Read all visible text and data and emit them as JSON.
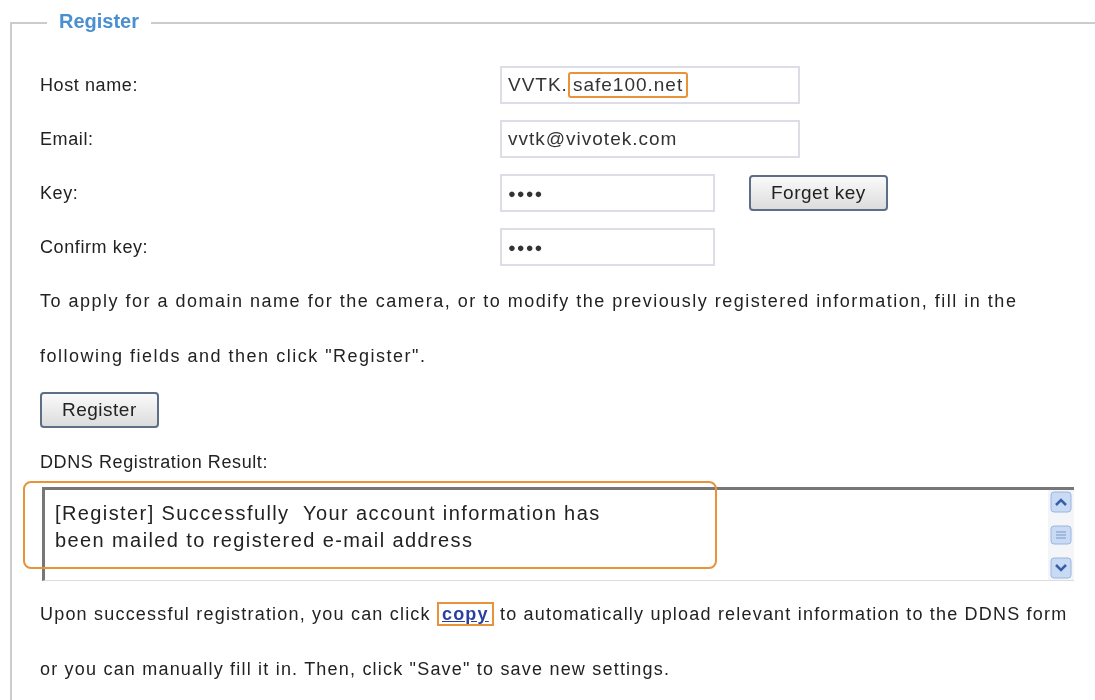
{
  "section": {
    "title": "Register"
  },
  "fields": [
    {
      "label": "Host name:",
      "kind": "text",
      "value_prefix": "VVTK.",
      "value_highlight": "safe100.net"
    },
    {
      "label": "Email:",
      "kind": "text",
      "value_prefix": "vvtk@vivotek.com"
    },
    {
      "label": "Key:",
      "kind": "password",
      "value_prefix": "●●●●",
      "button": "Forget key"
    },
    {
      "label": "Confirm key:",
      "kind": "password",
      "value_prefix": "●●●●"
    }
  ],
  "instructions": "To apply for a domain name for the camera, or to modify the previously registered information, fill in the following fields and then click \"Register\".",
  "register_button": "Register",
  "result": {
    "label": "DDNS Registration Result:",
    "text": "[Register] Successfully  Your account information has\nbeen mailed to registered e-mail address",
    "highlighted": true
  },
  "footer": {
    "before": "Upon successful registration, you can click",
    "link": "copy",
    "link_highlighted": true,
    "after": "to automatically upload relevant information to the DDNS form or you can manually fill it in. Then, click \"Save\" to save new settings."
  }
}
